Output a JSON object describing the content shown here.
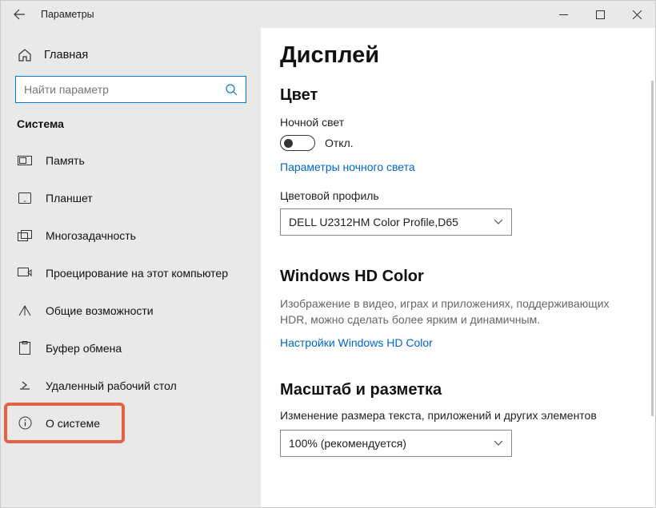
{
  "window": {
    "title": "Параметры"
  },
  "sidebar": {
    "home": "Главная",
    "search_placeholder": "Найти параметр",
    "section": "Система",
    "items": [
      {
        "label": "Память"
      },
      {
        "label": "Планшет"
      },
      {
        "label": "Многозадачность"
      },
      {
        "label": "Проецирование на этот компьютер"
      },
      {
        "label": "Общие возможности"
      },
      {
        "label": "Буфер обмена"
      },
      {
        "label": "Удаленный рабочий стол"
      },
      {
        "label": "О системе"
      }
    ]
  },
  "main": {
    "heading": "Дисплей",
    "color": {
      "title": "Цвет",
      "nightlight_label": "Ночной свет",
      "nightlight_state": "Откл.",
      "nightlight_link": "Параметры ночного света",
      "profile_label": "Цветовой профиль",
      "profile_value": "DELL U2312HM Color Profile,D65"
    },
    "hd": {
      "title": "Windows HD Color",
      "desc": "Изображение в видео, играх и приложениях, поддерживающих HDR, можно сделать более ярким и динамичным.",
      "link": "Настройки Windows HD Color"
    },
    "scale": {
      "title": "Масштаб и разметка",
      "desc": "Изменение размера текста, приложений и других элементов",
      "value": "100% (рекомендуется)"
    }
  }
}
